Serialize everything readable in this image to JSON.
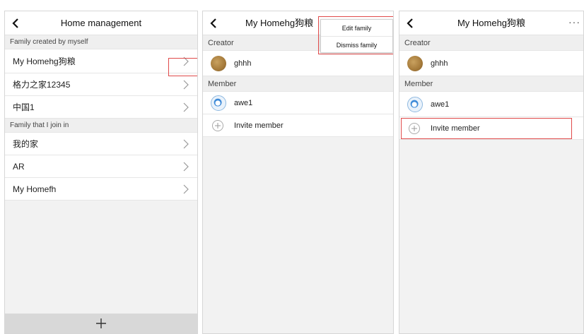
{
  "screen1": {
    "title": "Home management",
    "section_created": "Family created by myself",
    "created_items": [
      "My Homehg狗粮",
      "格力之家12345",
      "中国1"
    ],
    "section_joined": "Family that I join in",
    "joined_items": [
      "我的家",
      "AR",
      "My Homefh"
    ]
  },
  "screen2": {
    "title": "My Homehg狗粮",
    "creator_header": "Creator",
    "creator_name": "ghhh",
    "member_header": "Member",
    "member_name": "awe1",
    "invite_label": "Invite member",
    "menu": {
      "edit": "Edit family",
      "dismiss": "Dismiss family"
    }
  },
  "screen3": {
    "title": "My Homehg狗粮",
    "more_icon": "···",
    "creator_header": "Creator",
    "creator_name": "ghhh",
    "member_header": "Member",
    "member_name": "awe1",
    "invite_label": "Invite member"
  },
  "colors": {
    "highlight": "#e04a4a",
    "background": "#f2f2f2",
    "row": "#ffffff"
  }
}
